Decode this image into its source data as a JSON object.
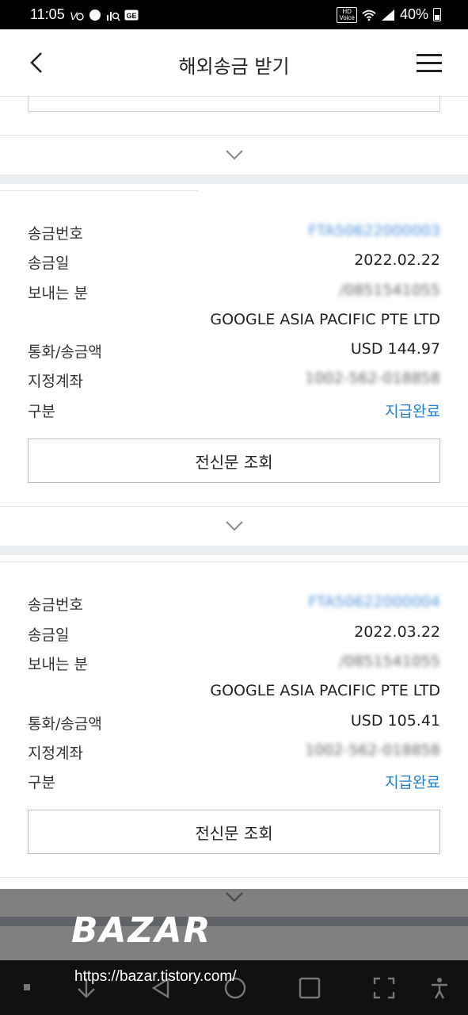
{
  "status_bar": {
    "time": "11:05",
    "battery_percent": "40%",
    "hd_label": "HD\nVoice"
  },
  "header": {
    "title": "해외송금 받기"
  },
  "labels": {
    "remit_no": "송금번호",
    "remit_date": "송금일",
    "sender": "보내는 분",
    "currency_amount": "통화/송금액",
    "account": "지정계좌",
    "category": "구분"
  },
  "records": [
    {
      "remit_no": "FTA50622000003",
      "remit_date": "2022.02.22",
      "sender_id": "/0851541055",
      "sender_name": "GOOGLE ASIA PACIFIC PTE LTD",
      "currency_amount": "USD 144.97",
      "account": "1002-562-018858",
      "status": "지급완료",
      "detail_button": "전신문 조회"
    },
    {
      "remit_no": "FTA50622000004",
      "remit_date": "2022.03.22",
      "sender_id": "/0851541055",
      "sender_name": "GOOGLE ASIA PACIFIC PTE LTD",
      "currency_amount": "USD 105.41",
      "account": "1002-562-018858",
      "status": "지급완료",
      "detail_button": "전신문 조회"
    }
  ],
  "watermark": {
    "brand": "BAZAR",
    "url": "https://bazar.tistory.com/"
  },
  "colors": {
    "accent_blue": "#1f7fd6",
    "band_gray": "#ebeef1"
  }
}
